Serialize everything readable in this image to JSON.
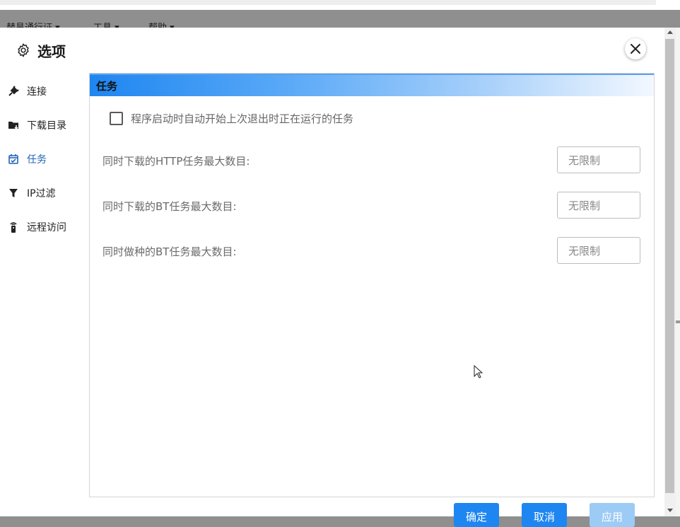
{
  "background_menu": [
    "替昌通行证 ▾",
    "工具 ▾",
    "帮助 ▾"
  ],
  "dialog": {
    "title": "选项",
    "title_icon": "gear-icon",
    "close_icon": "close-icon"
  },
  "sidebar": {
    "items": [
      {
        "label": "连接",
        "icon": "plug-icon",
        "active": false
      },
      {
        "label": "下载目录",
        "icon": "folder-download-icon",
        "active": false
      },
      {
        "label": "任务",
        "icon": "calendar-check-icon",
        "active": true
      },
      {
        "label": "IP过滤",
        "icon": "filter-icon",
        "active": false
      },
      {
        "label": "远程访问",
        "icon": "remote-icon",
        "active": false
      }
    ]
  },
  "panel": {
    "header": "任务",
    "autostart_checkbox": {
      "label": "程序启动时自动开始上次退出时正在运行的任务",
      "checked": false
    },
    "rows": [
      {
        "label": "同时下载的HTTP任务最大数目:",
        "value": "无限制"
      },
      {
        "label": "同时下载的BT任务最大数目:",
        "value": "无限制"
      },
      {
        "label": "同时做种的BT任务最大数目:",
        "value": "无限制"
      }
    ]
  },
  "buttons": {
    "ok": "确定",
    "cancel": "取消",
    "apply": "应用"
  },
  "colors": {
    "accent": "#1e86f0",
    "active_nav": "#1f64b5",
    "button_primary": "#1e86f0",
    "button_disabled": "#9ccbf5"
  }
}
